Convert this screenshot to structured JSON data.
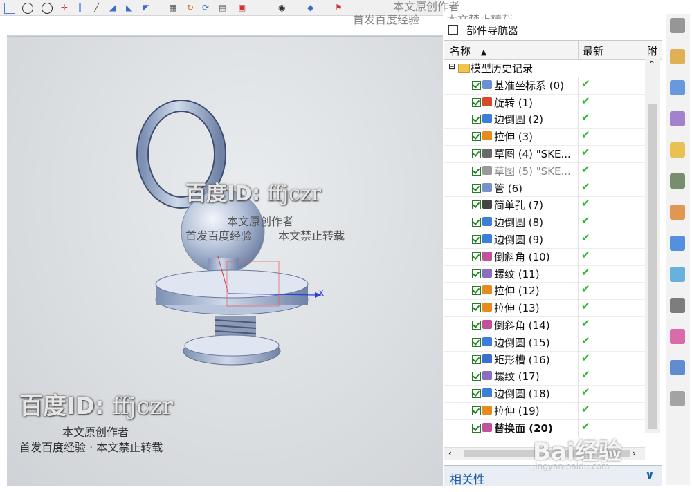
{
  "watermark_top": {
    "line1": "本文原创作者",
    "line2a": "首发百度经验",
    "line2b": "本文禁止转载"
  },
  "watermark_center": {
    "id_prefix": "百度ID:",
    "id_name": "ffjczr",
    "line1": "本文原创作者",
    "line2a": "首发百度经验",
    "line2b": "本文禁止转载"
  },
  "watermark_bottom": {
    "id_prefix": "百度ID:",
    "id_name": "ffjczr",
    "line1": "本文原创作者",
    "line2": "首发百度经验 · 本文禁止转载"
  },
  "baidu_logo": {
    "text": "Bai经验",
    "url": "jingyan.baidu.com"
  },
  "axis_label": "X",
  "navigator": {
    "title": "部件导航器",
    "columns": {
      "name": "名称",
      "latest": "最新",
      "attached": "附注"
    },
    "root": "模型历史记录",
    "features": [
      {
        "label": "基准坐标系 (0)",
        "latest": "✔",
        "icon": "csys-icon",
        "color": "#6b8fd6"
      },
      {
        "label": "旋转 (1)",
        "latest": "✔",
        "icon": "revolve-icon",
        "color": "#d9482b"
      },
      {
        "label": "边倒圆 (2)",
        "latest": "✔",
        "icon": "blend-icon",
        "color": "#3d7ed8"
      },
      {
        "label": "拉伸 (3)",
        "latest": "✔",
        "icon": "extrude-icon",
        "color": "#e78b1f"
      },
      {
        "label": "草图 (4) \"SKE...",
        "latest": "✔",
        "icon": "sketch-icon",
        "color": "#6a6a6a"
      },
      {
        "label": "草图 (5) \"SKE...",
        "latest": "✔",
        "icon": "sketch-icon",
        "color": "#9a9a9a"
      },
      {
        "label": "管 (6)",
        "latest": "✔",
        "icon": "tube-icon",
        "color": "#7a92c8"
      },
      {
        "label": "简单孔 (7)",
        "latest": "✔",
        "icon": "hole-icon",
        "color": "#444444"
      },
      {
        "label": "边倒圆 (8)",
        "latest": "✔",
        "icon": "blend-icon",
        "color": "#3d7ed8"
      },
      {
        "label": "边倒圆 (9)",
        "latest": "✔",
        "icon": "blend-icon",
        "color": "#3d7ed8"
      },
      {
        "label": "倒斜角 (10)",
        "latest": "✔",
        "icon": "chamfer-icon",
        "color": "#c2509a"
      },
      {
        "label": "螺纹 (11)",
        "latest": "✔",
        "icon": "thread-icon",
        "color": "#8a6ec0"
      },
      {
        "label": "拉伸 (12)",
        "latest": "✔",
        "icon": "extrude-icon",
        "color": "#e78b1f"
      },
      {
        "label": "拉伸 (13)",
        "latest": "✔",
        "icon": "extrude-icon",
        "color": "#e78b1f"
      },
      {
        "label": "倒斜角 (14)",
        "latest": "✔",
        "icon": "chamfer-icon",
        "color": "#c2509a"
      },
      {
        "label": "边倒圆 (15)",
        "latest": "✔",
        "icon": "blend-icon",
        "color": "#3d7ed8"
      },
      {
        "label": "矩形槽 (16)",
        "latest": "✔",
        "icon": "groove-icon",
        "color": "#3c6fd0"
      },
      {
        "label": "螺纹 (17)",
        "latest": "✔",
        "icon": "thread-icon",
        "color": "#8a6ec0"
      },
      {
        "label": "边倒圆 (18)",
        "latest": "✔",
        "icon": "blend-icon",
        "color": "#3d7ed8"
      },
      {
        "label": "拉伸 (19)",
        "latest": "✔",
        "icon": "extrude-icon",
        "color": "#e78b1f"
      },
      {
        "label": "替换面 (20)",
        "latest": "✔",
        "icon": "replace-face-icon",
        "color": "#c2509a"
      }
    ],
    "footer": "相关性"
  },
  "sidebar_icons": [
    "gear-icon",
    "assembly-icon",
    "constraint-icon",
    "part-navigator-icon",
    "reuse-library-icon",
    "view-icon",
    "roles-icon",
    "info-icon",
    "history-icon",
    "clock-icon",
    "palette-icon",
    "process-icon",
    "tools-icon"
  ]
}
